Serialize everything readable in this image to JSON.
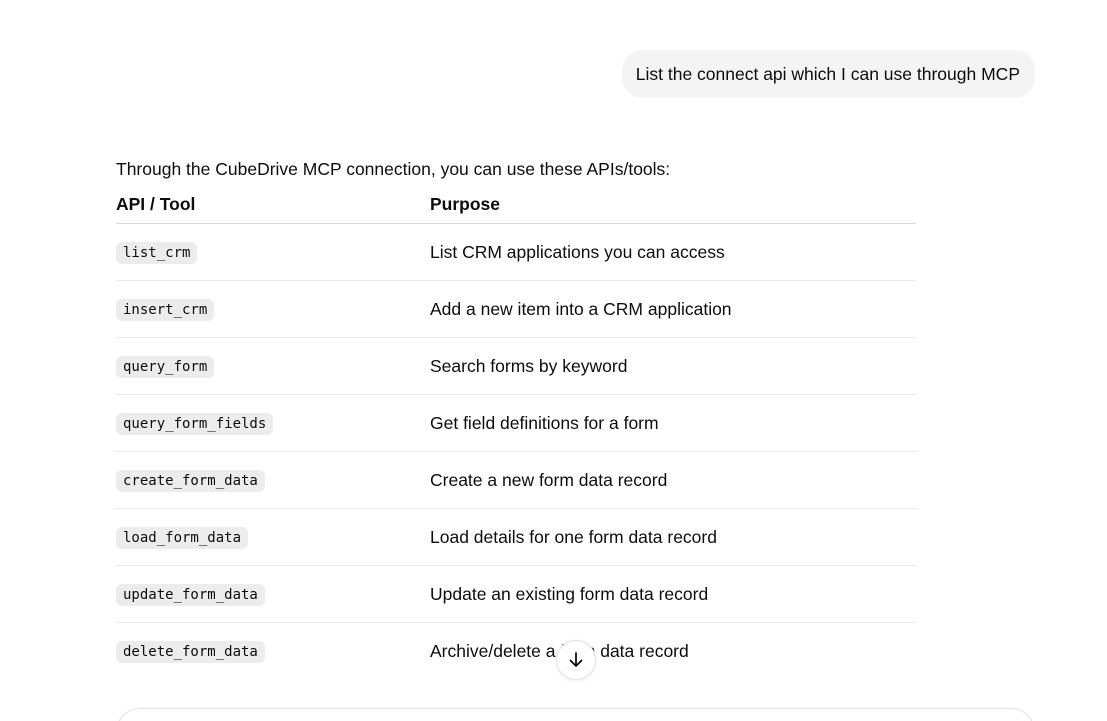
{
  "conversation": {
    "user_message": "List the connect api which I can use through MCP",
    "assistant": {
      "intro": "Through the CubeDrive MCP connection, you can use these APIs/tools:",
      "table": {
        "headers": [
          "API / Tool",
          "Purpose"
        ],
        "rows": [
          {
            "api": "list_crm",
            "purpose": "List CRM applications you can access"
          },
          {
            "api": "insert_crm",
            "purpose": "Add a new item into a CRM application"
          },
          {
            "api": "query_form",
            "purpose": "Search forms by keyword"
          },
          {
            "api": "query_form_fields",
            "purpose": "Get field definitions for a form"
          },
          {
            "api": "create_form_data",
            "purpose": "Create a new form data record"
          },
          {
            "api": "load_form_data",
            "purpose": "Load details for one form data record"
          },
          {
            "api": "update_form_data",
            "purpose": "Update an existing form data record"
          },
          {
            "api": "delete_form_data",
            "purpose": "Archive/delete a form data record"
          }
        ]
      }
    }
  },
  "controls": {
    "scroll_down_icon": "arrow-down-icon"
  },
  "colors": {
    "user_bubble_bg": "#f4f4f4",
    "code_bg": "#ececec",
    "text": "#0d0d0d"
  }
}
